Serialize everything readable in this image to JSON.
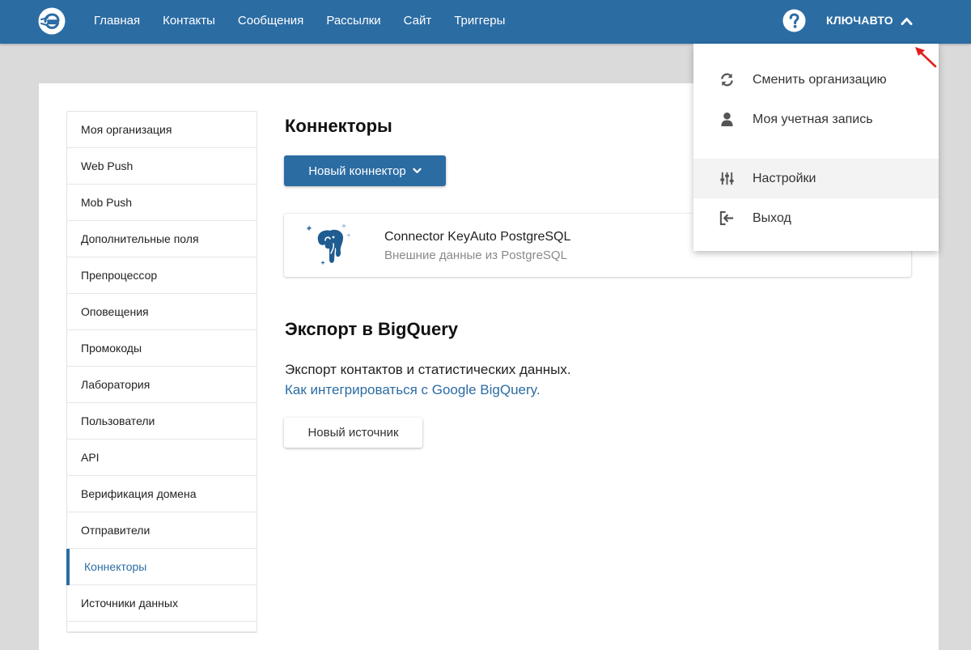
{
  "nav": {
    "items": [
      "Главная",
      "Контакты",
      "Сообщения",
      "Рассылки",
      "Сайт",
      "Триггеры"
    ],
    "org_name": "КЛЮЧАВТО"
  },
  "dropdown": {
    "items": [
      {
        "label": "Сменить организацию",
        "icon": "sync-icon"
      },
      {
        "label": "Моя учетная запись",
        "icon": "user-icon"
      },
      {
        "label": "Настройки",
        "icon": "sliders-icon"
      },
      {
        "label": "Выход",
        "icon": "sign-out-icon"
      }
    ]
  },
  "sidebar": {
    "items": [
      {
        "label": "Моя организация"
      },
      {
        "label": "Web Push"
      },
      {
        "label": "Mob Push"
      },
      {
        "label": "Дополнительные поля"
      },
      {
        "label": "Препроцессор"
      },
      {
        "label": "Оповещения"
      },
      {
        "label": "Промокоды"
      },
      {
        "label": "Лаборатория"
      },
      {
        "label": "Пользователи"
      },
      {
        "label": "API"
      },
      {
        "label": "Верификация домена"
      },
      {
        "label": "Отправители"
      },
      {
        "label": "Коннекторы",
        "active": true
      },
      {
        "label": "Источники данных"
      }
    ]
  },
  "connectors": {
    "title": "Коннекторы",
    "new_button": "Новый коннектор",
    "card": {
      "title": "Connector KeyAuto PostgreSQL",
      "subtitle": "Внешние данные из PostgreSQL"
    }
  },
  "bigquery": {
    "title": "Экспорт в BigQuery",
    "description": "Экспорт контактов и статистических данных.",
    "link": "Как интегрироваться с Google BigQuery.",
    "new_source_button": "Новый источник"
  },
  "colors": {
    "brand": "#2b6ca3",
    "background": "#dadada",
    "pointer": "#e0201b"
  }
}
